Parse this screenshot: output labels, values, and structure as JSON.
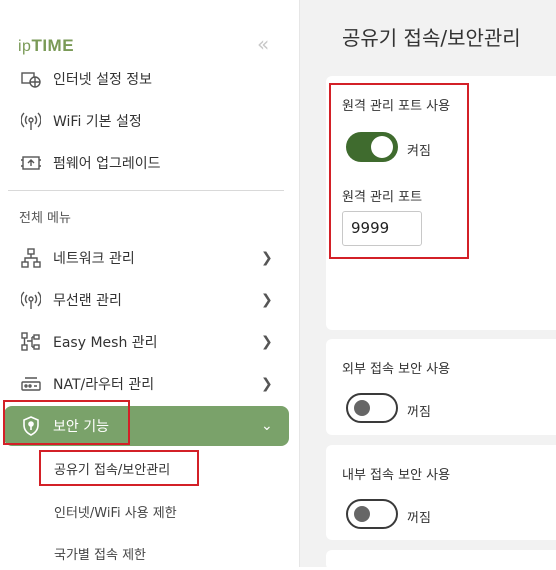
{
  "sidebar": {
    "logo": {
      "prefix": "ip",
      "brand": "TIME"
    },
    "collapse_icon": "double-chevron-left-icon",
    "top_items": [
      {
        "label": "인터넷 설정 정보",
        "icon": "internet-info-icon"
      },
      {
        "label": "WiFi 기본 설정",
        "icon": "wifi-icon"
      },
      {
        "label": "펌웨어 업그레이드",
        "icon": "firmware-icon"
      }
    ],
    "section_label": "전체 메뉴",
    "menu_items": [
      {
        "label": "네트워크 관리",
        "icon": "network-icon"
      },
      {
        "label": "무선랜 관리",
        "icon": "wireless-icon"
      },
      {
        "label": "Easy Mesh 관리",
        "icon": "mesh-icon"
      },
      {
        "label": "NAT/라우터 관리",
        "icon": "router-icon"
      },
      {
        "label": "보안 기능",
        "icon": "shield-icon",
        "active": true
      }
    ],
    "sub_items": [
      {
        "label": "공유기 접속/보안관리",
        "active": true
      },
      {
        "label": "인터넷/WiFi 사용 제한"
      },
      {
        "label": "국가별 접속 제한"
      }
    ]
  },
  "main": {
    "title": "공유기 접속/보안관리",
    "remote": {
      "label": "원격 관리 포트 사용",
      "state": "켜짐",
      "enabled": true,
      "port_label": "원격 관리 포트",
      "port_value": "9999"
    },
    "external": {
      "label": "외부 접속 보안 사용",
      "state": "꺼짐",
      "enabled": false
    },
    "internal": {
      "label": "내부 접속 보안 사용",
      "state": "꺼짐",
      "enabled": false
    }
  },
  "colors": {
    "accent": "#7aa26a",
    "toggle_on": "#3f6b2e",
    "highlight": "#d32027",
    "logo": "#7a9a57"
  }
}
